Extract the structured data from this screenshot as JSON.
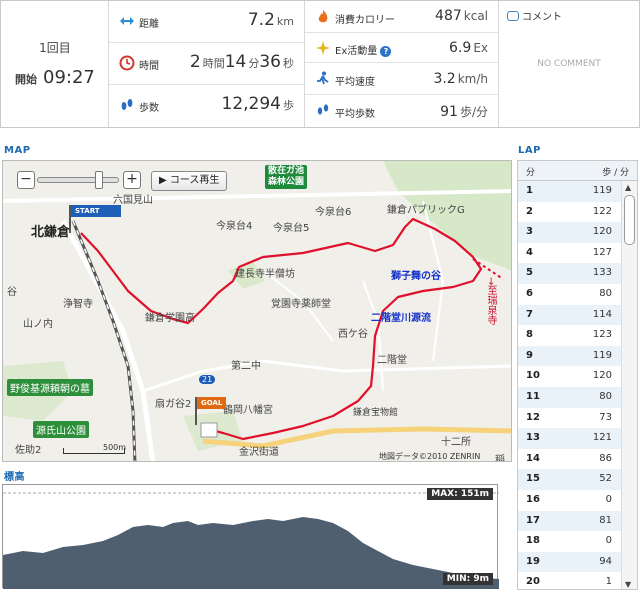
{
  "summary": {
    "lap_no": "1回目",
    "start_label": "開始",
    "start_time": "09:27",
    "distance": {
      "label": "距離",
      "value": "7.2",
      "unit": "km"
    },
    "time": {
      "label": "時間",
      "h": "2",
      "h_unit": "時間",
      "m": "14",
      "m_unit": "分",
      "s": "36",
      "s_unit": "秒"
    },
    "steps": {
      "label": "歩数",
      "value": "12,294",
      "unit": "歩"
    },
    "calories": {
      "label": "消費カロリー",
      "value": "487",
      "unit": "kcal"
    },
    "ex": {
      "label": "Ex活動量",
      "value": "6.9",
      "unit": "Ex"
    },
    "avg_speed": {
      "label": "平均速度",
      "value": "3.2",
      "unit": "km/h"
    },
    "avg_steps": {
      "label": "平均歩数",
      "value": "91",
      "unit": "歩/分"
    },
    "comment_label": "コメント",
    "no_comment": "NO COMMENT"
  },
  "map": {
    "title": "MAP",
    "course_play": "▶ コース再生",
    "scale_label": "500m",
    "copyright": "地図データ©2010 ZENRIN",
    "flag_start": "START",
    "flag_goal": "GOAL",
    "labels": {
      "kitakamakura": "北鎌倉",
      "rokkokuken": "六国見山",
      "imaizumi4": "今泉台4",
      "imaizumi5": "今泉台5",
      "imaizumi6": "今泉台6",
      "park_sanzai": "散在ガ池\n森林公園",
      "public_g": "鎌倉パブリックG",
      "shishimai": "獅子舞の谷",
      "nikaido_river": "二階堂川源流",
      "to_zuisenji": "→至瑞泉寺",
      "kenchoji": "建長寺半僧坊",
      "kakuonji": "覚園寺薬師堂",
      "kamakura_hs": "鎌倉学園高",
      "nishigaya": "西ケ谷",
      "nikaido": "二階堂",
      "jochiji": "浄智寺",
      "yamanouchi": "山ノ内",
      "tani": "谷",
      "daini_chu": "第二中",
      "route21": "21",
      "ogigayatsu": "扇ガ谷2",
      "hachimangu": "鶴岡八幡宮",
      "hoomotsukan": "鎌倉宝物館",
      "tomb": "源頼朝の墓",
      "tomb_prefix": "野俊基",
      "genjiyama": "源氏山公園",
      "sasuke": "佐助2",
      "jyunisho": "十二所",
      "kanazawa": "金沢街道",
      "inari": "稲"
    }
  },
  "elevation": {
    "title": "標高",
    "max_label": "MAX: 151m",
    "min_label": "MIN: 9m"
  },
  "lap": {
    "title": "LAP",
    "col_min": "分",
    "col_steps": "歩 / 分",
    "rows": [
      {
        "n": "1",
        "v": "119"
      },
      {
        "n": "2",
        "v": "122"
      },
      {
        "n": "3",
        "v": "120"
      },
      {
        "n": "4",
        "v": "127"
      },
      {
        "n": "5",
        "v": "133"
      },
      {
        "n": "6",
        "v": "80"
      },
      {
        "n": "7",
        "v": "114"
      },
      {
        "n": "8",
        "v": "123"
      },
      {
        "n": "9",
        "v": "119"
      },
      {
        "n": "10",
        "v": "120"
      },
      {
        "n": "11",
        "v": "80"
      },
      {
        "n": "12",
        "v": "73"
      },
      {
        "n": "13",
        "v": "121"
      },
      {
        "n": "14",
        "v": "86"
      },
      {
        "n": "15",
        "v": "52"
      },
      {
        "n": "16",
        "v": "0"
      },
      {
        "n": "17",
        "v": "81"
      },
      {
        "n": "18",
        "v": "0"
      },
      {
        "n": "19",
        "v": "94"
      },
      {
        "n": "20",
        "v": "1"
      }
    ]
  },
  "colors": {
    "accent": "#1e6ab3",
    "route": "#e0102a",
    "profile": "#4f5f70"
  }
}
